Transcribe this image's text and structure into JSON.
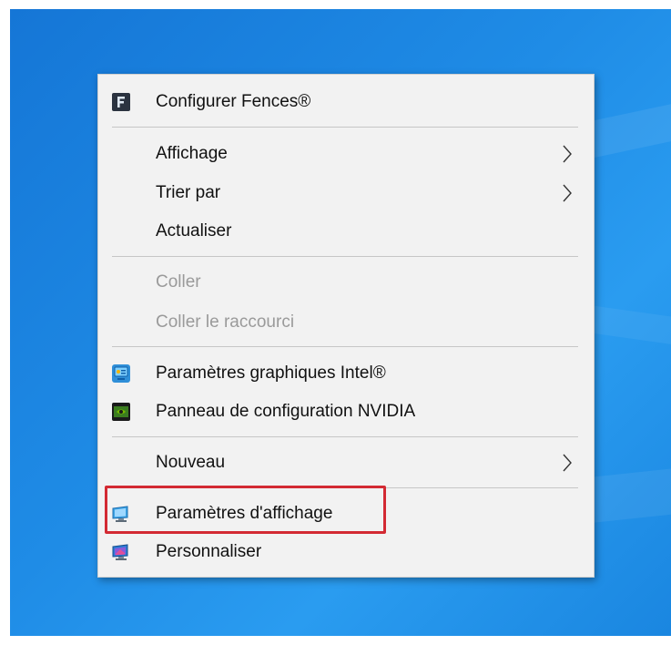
{
  "context_menu": {
    "items": [
      {
        "label": "Configurer Fences®",
        "icon": "fences-icon",
        "enabled": true
      },
      {
        "label": "Affichage",
        "submenu": true,
        "enabled": true
      },
      {
        "label": "Trier par",
        "submenu": true,
        "enabled": true
      },
      {
        "label": "Actualiser",
        "enabled": true
      },
      {
        "label": "Coller",
        "enabled": false
      },
      {
        "label": "Coller le raccourci",
        "enabled": false
      },
      {
        "label": "Paramètres graphiques Intel®",
        "icon": "intel-graphics-icon",
        "enabled": true
      },
      {
        "label": "Panneau de configuration NVIDIA",
        "icon": "nvidia-icon",
        "enabled": true
      },
      {
        "label": "Nouveau",
        "submenu": true,
        "enabled": true
      },
      {
        "label": "Paramètres d'affichage",
        "icon": "display-settings-icon",
        "enabled": true,
        "highlighted": true
      },
      {
        "label": "Personnaliser",
        "icon": "personalize-icon",
        "enabled": true
      }
    ]
  },
  "colors": {
    "desktop_background": "#1f8ce6",
    "menu_background": "#f2f2f2",
    "highlight_border": "#d32a33",
    "disabled_text": "#9a9a9a"
  }
}
